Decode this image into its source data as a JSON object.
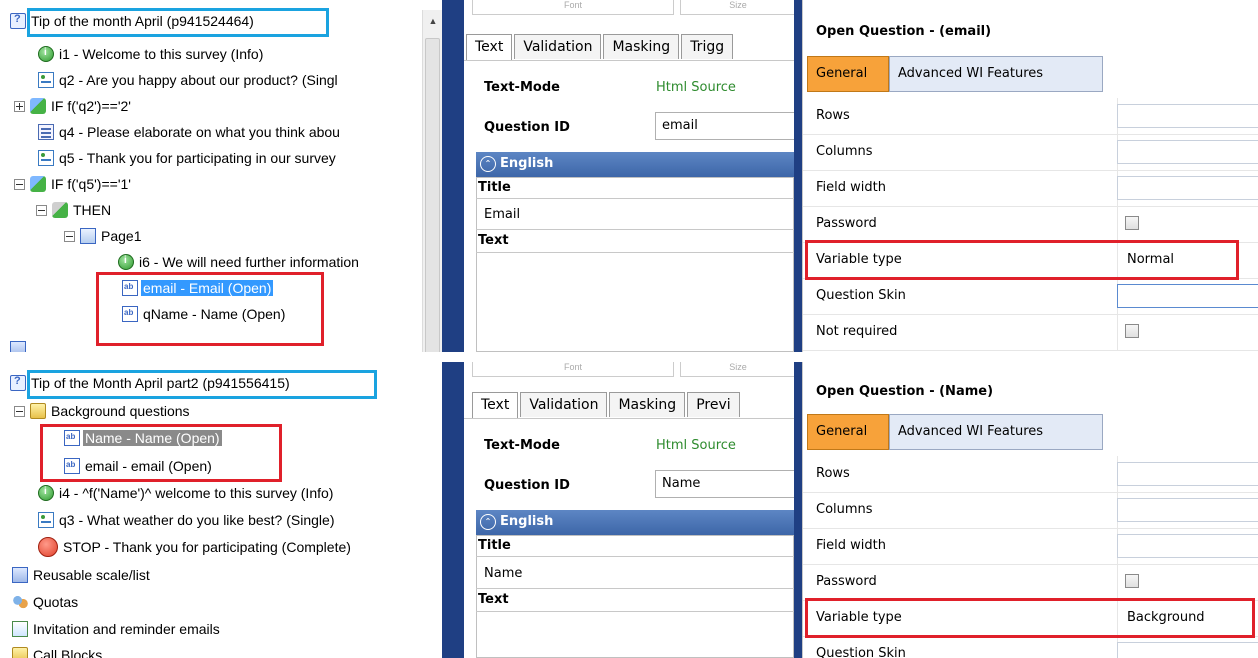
{
  "top": {
    "tree": {
      "survey_title": "Tip of the month April (p941524464)",
      "items": [
        {
          "icon": "info-icon",
          "label": "i1 - Welcome to this survey (Info)"
        },
        {
          "icon": "single-question-icon",
          "label": "q2 - Are you happy about our product? (Singl"
        },
        {
          "icon": "condition-icon",
          "label": "IF f('q2')=='2'"
        },
        {
          "icon": "multi-question-icon",
          "label": "q4 - Please elaborate on what you think abou"
        },
        {
          "icon": "single-question-icon",
          "label": "q5 - Thank you for participating in our survey"
        },
        {
          "icon": "condition-icon",
          "label": "IF f('q5')=='1'"
        },
        {
          "icon": "then-icon",
          "label": "THEN"
        },
        {
          "icon": "page-icon",
          "label": "Page1"
        },
        {
          "icon": "info-icon",
          "label": "i6 - We will need further information"
        },
        {
          "icon": "open-question-icon",
          "label": "email - Email (Open)"
        },
        {
          "icon": "open-question-icon",
          "label": "qName - Name (Open)"
        }
      ]
    },
    "editor": {
      "faded_labels": [
        "Font",
        "Size"
      ],
      "tabs": [
        "Text",
        "Validation",
        "Masking",
        "Trigg"
      ],
      "text_mode_label": "Text-Mode",
      "text_mode_value": "Html Source",
      "question_id_label": "Question ID",
      "question_id_value": "email",
      "language": "English",
      "title_label": "Title",
      "title_value": "Email",
      "text_label": "Text"
    },
    "props": {
      "title": "Open Question - (email)",
      "tab_general": "General",
      "tab_advanced": "Advanced WI Features",
      "rows": [
        {
          "label": "Rows",
          "kind": "input",
          "value": ""
        },
        {
          "label": "Columns",
          "kind": "input",
          "value": ""
        },
        {
          "label": "Field width",
          "kind": "input",
          "value": ""
        },
        {
          "label": "Password",
          "kind": "checkbox",
          "value": ""
        },
        {
          "label": "Variable type",
          "kind": "text",
          "value": "Normal"
        },
        {
          "label": "Question Skin",
          "kind": "input",
          "value": ""
        },
        {
          "label": "Not required",
          "kind": "checkbox",
          "value": ""
        }
      ]
    }
  },
  "bottom": {
    "tree": {
      "survey_title": "Tip of the Month April part2 (p941556415)",
      "items": [
        {
          "icon": "folder-icon",
          "label": "Background questions"
        },
        {
          "icon": "open-question-icon",
          "label": "Name - Name (Open)"
        },
        {
          "icon": "open-question-icon",
          "label": "email - email (Open)"
        },
        {
          "icon": "info-icon",
          "label": "i4 - ^f('Name')^ welcome to this survey (Info)"
        },
        {
          "icon": "single-question-icon",
          "label": "q3 - What weather do you like best? (Single)"
        },
        {
          "icon": "stop-icon",
          "label": "STOP - Thank you for participating (Complete)"
        },
        {
          "icon": "scale-icon",
          "label": "Reusable scale/list"
        },
        {
          "icon": "quota-icon",
          "label": "Quotas"
        },
        {
          "icon": "email-icon",
          "label": "Invitation and reminder emails"
        },
        {
          "icon": "folder-icon",
          "label": "Call Blocks"
        }
      ]
    },
    "editor": {
      "faded_labels": [
        "Font",
        "Size"
      ],
      "tabs": [
        "Text",
        "Validation",
        "Masking",
        "Previ"
      ],
      "text_mode_label": "Text-Mode",
      "text_mode_value": "Html Source",
      "question_id_label": "Question ID",
      "question_id_value": "Name",
      "language": "English",
      "title_label": "Title",
      "title_value": "Name",
      "text_label": "Text"
    },
    "props": {
      "title": "Open Question - (Name)",
      "tab_general": "General",
      "tab_advanced": "Advanced WI Features",
      "rows": [
        {
          "label": "Rows",
          "kind": "input",
          "value": ""
        },
        {
          "label": "Columns",
          "kind": "input",
          "value": ""
        },
        {
          "label": "Field width",
          "kind": "input",
          "value": ""
        },
        {
          "label": "Password",
          "kind": "checkbox",
          "value": ""
        },
        {
          "label": "Variable type",
          "kind": "text",
          "value": "Background"
        },
        {
          "label": "Question Skin",
          "kind": "input",
          "value": ""
        }
      ]
    }
  },
  "colors": {
    "highlight_red": "#e0202a",
    "highlight_blue": "#1aa3e0",
    "selection": "#3399ff",
    "general_tab": "#f7a23a",
    "language_header": "#3d66a8"
  }
}
